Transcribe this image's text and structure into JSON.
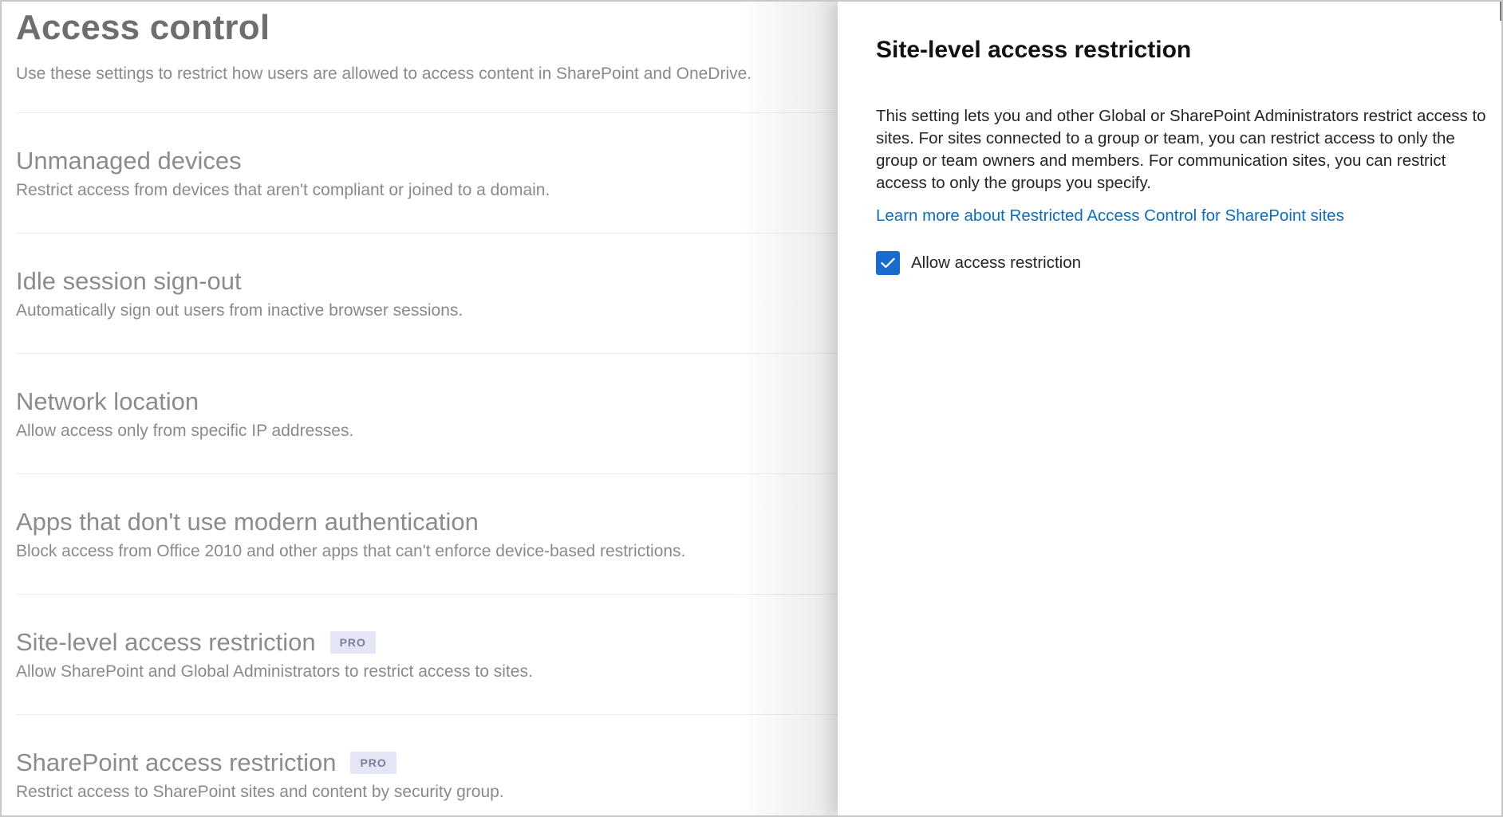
{
  "page": {
    "title": "Access control",
    "description": "Use these settings to restrict how users are allowed to access content in SharePoint and OneDrive."
  },
  "sections": [
    {
      "title": "Unmanaged devices",
      "description": "Restrict access from devices that aren't compliant or joined to a domain.",
      "badge": ""
    },
    {
      "title": "Idle session sign-out",
      "description": "Automatically sign out users from inactive browser sessions.",
      "badge": ""
    },
    {
      "title": "Network location",
      "description": "Allow access only from specific IP addresses.",
      "badge": ""
    },
    {
      "title": "Apps that don't use modern authentication",
      "description": "Block access from Office 2010 and other apps that can't enforce device-based restrictions.",
      "badge": ""
    },
    {
      "title": "Site-level access restriction",
      "description": "Allow SharePoint and Global Administrators to restrict access to sites.",
      "badge": "PRO"
    },
    {
      "title": "SharePoint access restriction",
      "description": "Restrict access to SharePoint sites and content by security group.",
      "badge": "PRO"
    }
  ],
  "panel": {
    "title": "Site-level access restriction",
    "description": "This setting lets you and other Global or SharePoint Administrators restrict access to sites. For sites connected to a group or team, you can restrict access to only the group or team owners and members. For communication sites, you can restrict access to only the groups you specify.",
    "link_text": "Learn more about Restricted Access Control for SharePoint sites",
    "checkbox": {
      "label": "Allow access restriction",
      "checked": true,
      "icon": "checkmark-icon"
    }
  },
  "colors": {
    "link": "#0f6cbd",
    "checkbox_fill": "#1a6ccc",
    "badge_bg": "#e4e6f6"
  }
}
